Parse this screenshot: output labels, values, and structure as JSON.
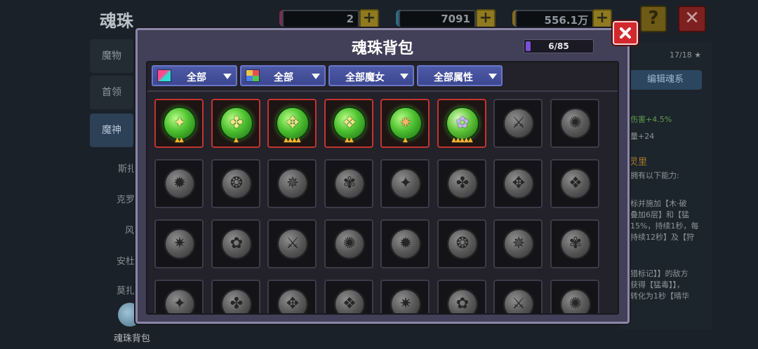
{
  "background": {
    "screen_title": "魂珠",
    "resources": [
      {
        "icon": "purple-gem-icon",
        "value": "2"
      },
      {
        "icon": "blue-diamond-icon",
        "value": "7091"
      },
      {
        "icon": "gold-coin-icon",
        "value": "556.1万"
      }
    ],
    "help_label": "?",
    "close_label": "✕",
    "side_tabs": [
      "魔物",
      "首领",
      "魔神"
    ],
    "side_items": [
      "斯扎",
      "克罗",
      "风",
      "安杜",
      "莫扎"
    ],
    "level_text": "17/18 ★",
    "edit_button": "编辑魂系",
    "panel_lines": [
      "伤害+4.5%",
      "量+24",
      "灵里",
      "拥有以下能力:",
      "标并施加【木·破",
      "叠加6层】和【猛",
      "15%，持续1秒，每",
      "持续12秒】及【狩",
      "猎标记】】的敌方",
      "获得【猛毒】】，",
      "转化为1秒【晴华"
    ],
    "bag_label": "魂珠背包"
  },
  "modal": {
    "title": "魂珠背包",
    "capacity_text": "6/85",
    "capacity_fraction": 0.07,
    "close_icon": "close-x-icon",
    "filters": [
      {
        "label": "全部",
        "icon": "rainbow-element-icon"
      },
      {
        "label": "全部",
        "icon": "multicolor-grid-icon"
      },
      {
        "label": "全部魔女",
        "icon": ""
      },
      {
        "label": "全部属性",
        "icon": ""
      }
    ],
    "owned_orbs": [
      {
        "name": "green-beast-orb",
        "stars": 2
      },
      {
        "name": "yellow-rune-orb",
        "stars": 1
      },
      {
        "name": "clover-beast-orb",
        "stars": 4
      },
      {
        "name": "serpent-orb",
        "stars": 2
      },
      {
        "name": "flame-sword-orb",
        "stars": 1
      },
      {
        "name": "spirit-fan-orb",
        "stars": 5
      }
    ],
    "locked_orbs": [
      "axe-orb",
      "crescent-orb",
      "blade-orb",
      "gate-orb",
      "sword-orb",
      "dragon-orb",
      "hat-orb",
      "cluster-orb",
      "drill-orb",
      "skull-orb",
      "spider-orb",
      "beast-orb",
      "bird-orb",
      "flower-orb",
      "cross-orb",
      "chain-orb",
      "mace-orb",
      "bow-orb",
      "rune-orb",
      "totem-orb",
      "shuriken-orb",
      "eye-orb",
      "arm-orb",
      "staff-orb",
      "claw-orb",
      "shell-orb"
    ]
  },
  "colors": {
    "modal_bg": "#423f58",
    "filter_blue": "#4552a0",
    "owned_border": "#c23530",
    "orb_green": "#4dc030",
    "star_gold": "#ffb22c",
    "capacity_purple": "#7b4fd8",
    "close_red": "#d2292c"
  }
}
